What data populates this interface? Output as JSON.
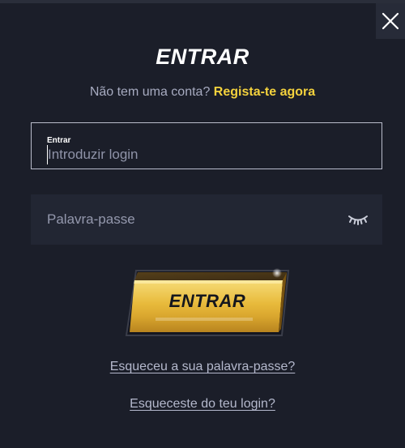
{
  "modal": {
    "title": "ENTRAR",
    "signup_prompt": "Não tem uma conta?",
    "signup_link": "Regista-te agora",
    "close_icon": "close-icon"
  },
  "login_field": {
    "label": "Entrar",
    "placeholder": "Introduzir login",
    "value": ""
  },
  "password_field": {
    "placeholder": "Palavra-passe",
    "value": "",
    "toggle_icon": "eye-closed-icon"
  },
  "submit": {
    "label": "ENTRAR"
  },
  "links": {
    "forgot_password": "Esqueceu a sua palavra-passe?",
    "forgot_login": "Esqueceste do teu login?"
  },
  "colors": {
    "background": "#1b1e29",
    "accent_yellow": "#f4d23d",
    "button_gold": "#e7b93a"
  }
}
